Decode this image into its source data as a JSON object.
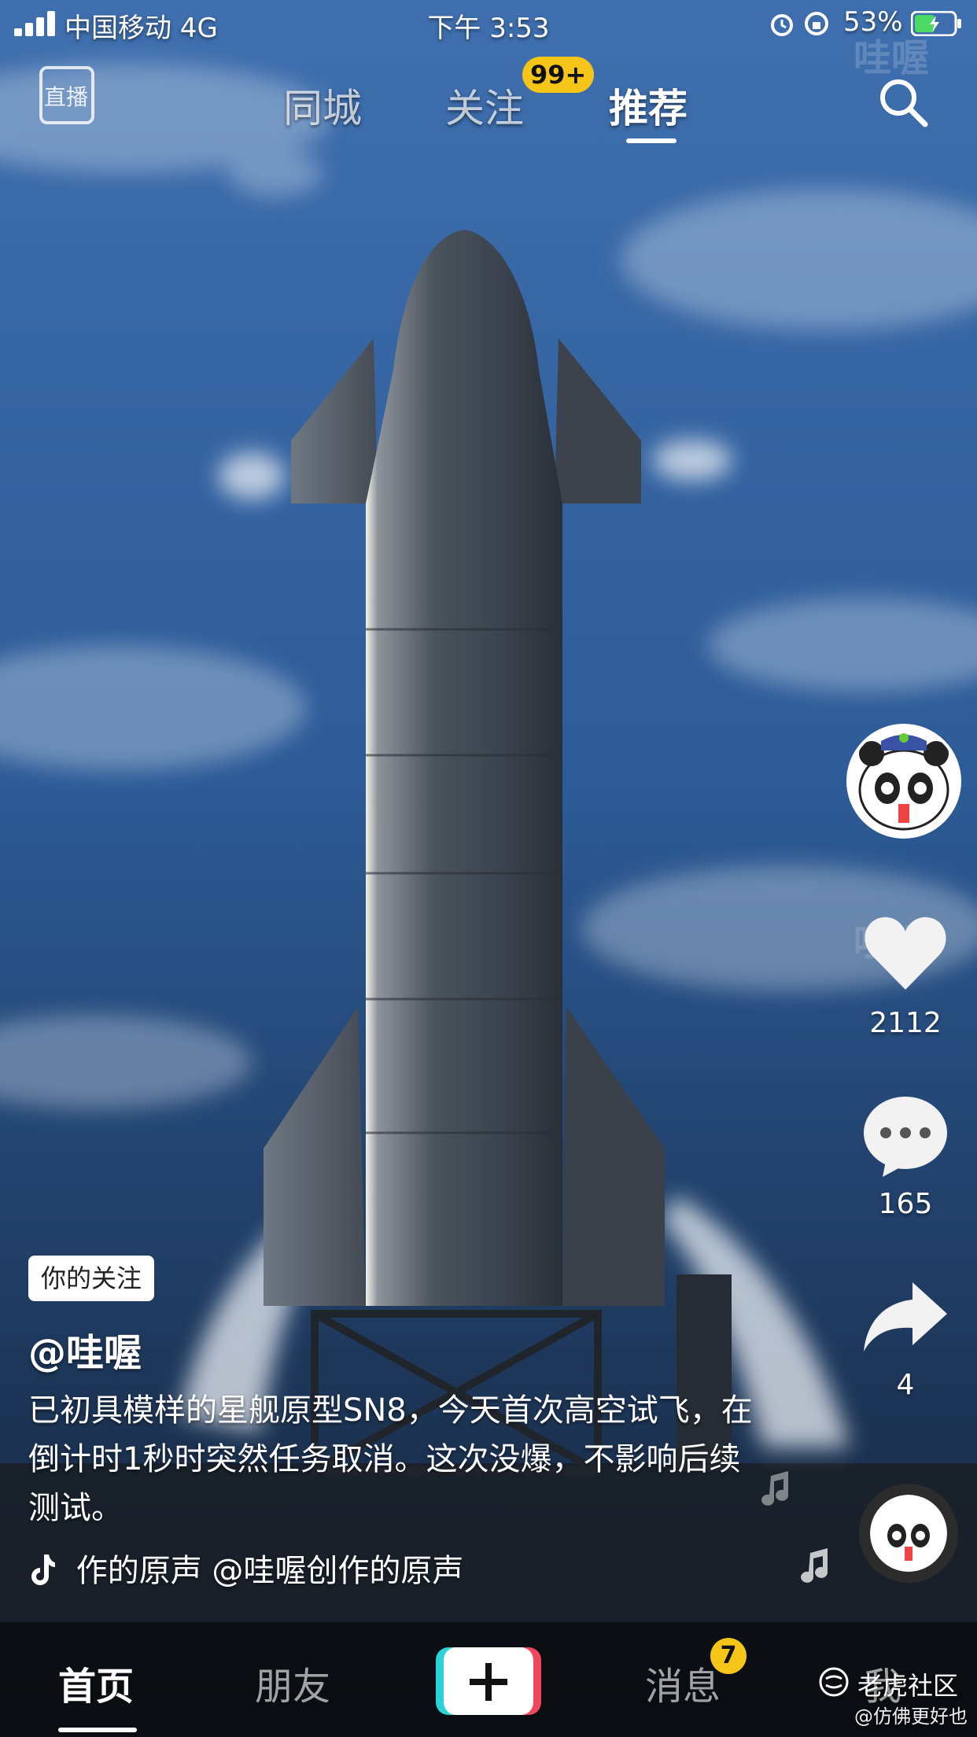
{
  "status_bar": {
    "carrier": "中国移动 4G",
    "time": "下午 3:53",
    "battery_percent": "53%",
    "battery_level": 0.53
  },
  "top_nav": {
    "live_label": "直播",
    "tabs": [
      {
        "label": "同城"
      },
      {
        "label": "关注",
        "badge": "99+"
      },
      {
        "label": "推荐"
      }
    ],
    "active_tab": "推荐",
    "watermark_brand": "哇喔"
  },
  "right_rail": {
    "likes": "2112",
    "comments": "165",
    "shares": "4"
  },
  "caption": {
    "follow_tag": "你的关注",
    "author": "@哇喔",
    "text": "已初具模样的星舰原型SN8，今天首次高空试飞，在倒计时1秒时突然任务取消。这次没爆，不影响后续测试。",
    "music": "作的原声    @哇喔创作的原声"
  },
  "bottom_nav": {
    "items": [
      {
        "label": "首页"
      },
      {
        "label": "朋友"
      },
      {
        "label": "消息",
        "badge": "7"
      },
      {
        "label": "我"
      }
    ],
    "active": "首页"
  },
  "watermark": {
    "site": "老虎社区",
    "handle": "@仿佛更好也"
  },
  "colors": {
    "badge": "#f5c518",
    "sky_top": "#2f5a96",
    "sky_bottom": "#162a48"
  }
}
